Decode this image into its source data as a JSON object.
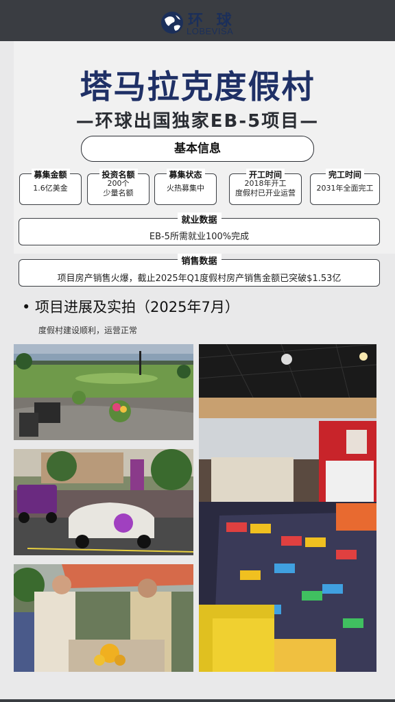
{
  "logo": {
    "cn": "环 球",
    "en": "LOBEVISA"
  },
  "title": "塔马拉克度假村",
  "subtitle": "—环球出国独家EB-5项目—",
  "basic_info_label": "基本信息",
  "info_boxes": [
    {
      "label": "募集金额",
      "value": "1.6亿美金"
    },
    {
      "label": "投资名额",
      "value": "200个\n少量名额"
    },
    {
      "label": "募集状态",
      "value": "火热募集中"
    },
    {
      "label": "开工时间",
      "value": "2018年开工\n度假村已开业运营"
    },
    {
      "label": "完工时间",
      "value": "2031年全面完工"
    }
  ],
  "employment": {
    "label": "就业数据",
    "value": "EB-5所需就业100%完成"
  },
  "sales": {
    "label": "销售数据",
    "value": "项目房产销售火爆，截止2025年Q1度假村房产销售金额已突破$1.53亿"
  },
  "progress": {
    "title": "• 项目进展及实拍（2025年7月）",
    "subtitle": "度假村建设顺利，运营正常"
  },
  "colors": {
    "navy": "#1f3066",
    "dark": "#2a2d33",
    "background": "#e9e9ea"
  }
}
